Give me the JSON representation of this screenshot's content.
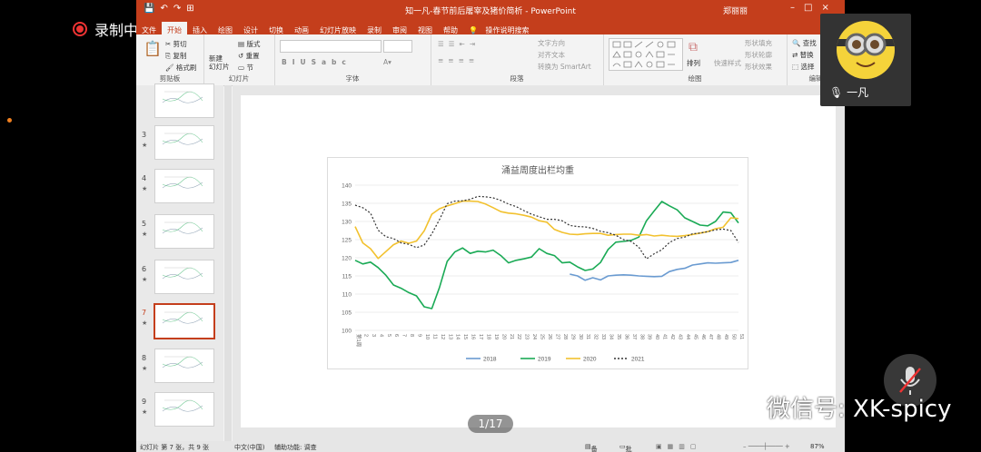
{
  "recording": {
    "label": "录制中"
  },
  "window": {
    "title": "知一凡-春节前后屠宰及猪价简析  -  PowerPoint",
    "user": "郑丽丽",
    "tabs": [
      "文件",
      "开始",
      "插入",
      "绘图",
      "设计",
      "切换",
      "动画",
      "幻灯片放映",
      "录制",
      "审阅",
      "视图",
      "帮助",
      "操作说明搜索"
    ],
    "active_tab": "开始"
  },
  "ribbon": {
    "clipboard": {
      "cut": "剪切",
      "copy": "复制",
      "format_painter": "格式刷",
      "label": "剪贴板"
    },
    "slides": {
      "new_slide_1": "新建",
      "new_slide_2": "幻灯片",
      "layout": "版式",
      "reset": "重置",
      "section": "节",
      "label": "幻灯片"
    },
    "font": {
      "label": "字体"
    },
    "paragraph": {
      "text_direction": "文字方向",
      "align_text": "对齐文本",
      "smartart": "转换为 SmartArt",
      "label": "段落"
    },
    "drawing": {
      "arrange": "排列",
      "quick_styles": "快速样式",
      "fill": "形状填充",
      "outline": "形状轮廓",
      "effects": "形状效果",
      "label": "绘图"
    },
    "editing": {
      "find": "查找",
      "replace": "替换",
      "select": "选择",
      "label": "编辑"
    }
  },
  "thumbnails": [
    {
      "num": "",
      "star": "",
      "selected": false
    },
    {
      "num": "3",
      "star": "★",
      "selected": false
    },
    {
      "num": "4",
      "star": "★",
      "selected": false
    },
    {
      "num": "5",
      "star": "★",
      "selected": false
    },
    {
      "num": "6",
      "star": "★",
      "selected": false
    },
    {
      "num": "7",
      "star": "★",
      "selected": true
    },
    {
      "num": "8",
      "star": "★",
      "selected": false
    },
    {
      "num": "9",
      "star": "★",
      "selected": false
    }
  ],
  "status": {
    "slide_info": "幻灯片 第 7 张，共 9 张",
    "language": "中文(中国)",
    "accessibility": "辅助功能: 调查",
    "notes": "备注",
    "comments": "批注",
    "zoom": "87%"
  },
  "page_indicator": "1/17",
  "camera": {
    "name": "一凡"
  },
  "watermark": {
    "text": "微信号: XK-spicy"
  },
  "chart_data": {
    "type": "line",
    "title": "涌益周度出栏均重",
    "ylim": [
      100,
      140
    ],
    "yticks": [
      100,
      105,
      110,
      115,
      120,
      125,
      130,
      135,
      140
    ],
    "x": [
      1,
      2,
      3,
      4,
      5,
      6,
      7,
      8,
      9,
      10,
      11,
      12,
      13,
      14,
      15,
      16,
      17,
      18,
      19,
      20,
      21,
      22,
      23,
      24,
      25,
      26,
      27,
      28,
      29,
      30,
      31,
      32,
      33,
      34,
      35,
      36,
      37,
      38,
      39,
      40,
      41,
      42,
      43,
      44,
      45,
      46,
      47,
      48,
      49,
      50,
      51
    ],
    "x_first_label": "第1周",
    "series": [
      {
        "name": "2018",
        "color": "#6a9bd1",
        "dash": "",
        "values": [
          null,
          null,
          null,
          null,
          null,
          null,
          null,
          null,
          null,
          null,
          null,
          null,
          null,
          null,
          null,
          null,
          null,
          null,
          null,
          null,
          null,
          null,
          null,
          null,
          null,
          null,
          null,
          null,
          115.5,
          115,
          113.8,
          114.5,
          113.9,
          115,
          115.2,
          115.3,
          115.2,
          115,
          114.9,
          114.8,
          114.9,
          116.2,
          116.8,
          117.1,
          118,
          118.3,
          118.6,
          118.5,
          118.6,
          118.7,
          119.3
        ]
      },
      {
        "name": "2019",
        "color": "#1aaa55",
        "dash": "",
        "values": [
          119.3,
          118.3,
          118.8,
          117.3,
          115.2,
          112.5,
          111.6,
          110.4,
          109.5,
          106.5,
          106,
          111.8,
          119,
          121.6,
          122.7,
          121.2,
          121.8,
          121.6,
          122.1,
          120.6,
          118.6,
          119.3,
          119.7,
          120.2,
          122.5,
          121.2,
          120.6,
          118.6,
          118.8,
          117.5,
          116.5,
          116.9,
          118.7,
          122.3,
          124.3,
          124.5,
          124.8,
          125.7,
          130.2,
          132.9,
          135.5,
          134.3,
          133.2,
          131,
          130,
          129,
          128.8,
          130,
          132.6,
          132.4,
          129.6
        ]
      },
      {
        "name": "2020",
        "color": "#f2c12e",
        "dash": "",
        "values": [
          128.6,
          124.1,
          122.5,
          119.8,
          121.7,
          123.6,
          124.6,
          124,
          124.6,
          127.4,
          132,
          133.5,
          134.3,
          134.9,
          135.6,
          135.6,
          135.5,
          134.8,
          133.8,
          132.7,
          132.3,
          132.1,
          131.7,
          131.2,
          130.2,
          129.8,
          127.8,
          127,
          126.5,
          126.4,
          126.6,
          126.7,
          126.7,
          126.2,
          126.4,
          126.5,
          126.5,
          126.2,
          126.4,
          126,
          126.2,
          126,
          125.9,
          126.1,
          126.4,
          126.8,
          127.2,
          128,
          128.4,
          131,
          130.8
        ]
      },
      {
        "name": "2021",
        "color": "#333333",
        "dash": "2,2",
        "values": [
          134.5,
          133.8,
          132.3,
          127.6,
          125.8,
          125.3,
          124.1,
          123.7,
          122.8,
          123.5,
          126.6,
          130.5,
          134.9,
          135.6,
          135.7,
          136.1,
          136.9,
          136.8,
          136.5,
          135.8,
          134.8,
          134.1,
          133,
          132,
          131.3,
          130.6,
          130.6,
          130.2,
          128.9,
          128.6,
          128.5,
          128.1,
          127.3,
          126.9,
          126.2,
          125,
          124.5,
          122.9,
          119.7,
          121.1,
          122.2,
          124.2,
          125.3,
          125.7,
          126.6,
          126.8,
          127.2,
          127.7,
          127.9,
          127.5,
          124.2
        ]
      }
    ]
  }
}
